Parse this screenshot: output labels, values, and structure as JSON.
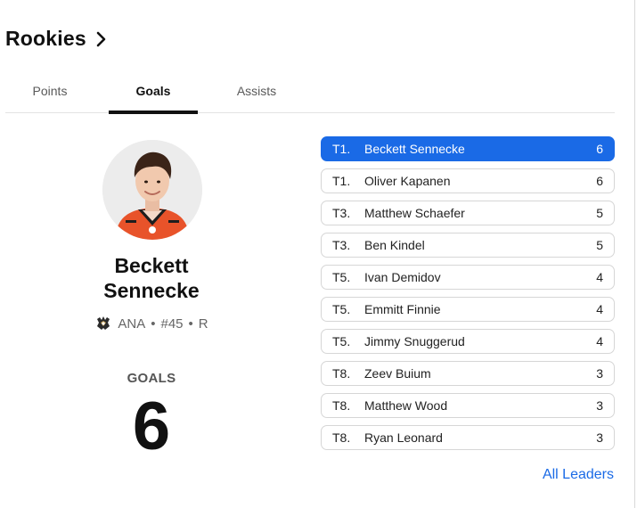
{
  "header": {
    "title": "Rookies"
  },
  "tabs": [
    {
      "label": "Points",
      "active": false
    },
    {
      "label": "Goals",
      "active": true
    },
    {
      "label": "Assists",
      "active": false
    }
  ],
  "featured": {
    "name_line1": "Beckett",
    "name_line2": "Sennecke",
    "team": "ANA",
    "number": "#45",
    "position": "R",
    "separator": "•",
    "team_logo_icon": "ducks-logo-icon",
    "stat_label": "GOALS",
    "stat_value": "6"
  },
  "leaders": [
    {
      "rank": "T1.",
      "name": "Beckett Sennecke",
      "value": "6"
    },
    {
      "rank": "T1.",
      "name": "Oliver Kapanen",
      "value": "6"
    },
    {
      "rank": "T3.",
      "name": "Matthew Schaefer",
      "value": "5"
    },
    {
      "rank": "T3.",
      "name": "Ben Kindel",
      "value": "5"
    },
    {
      "rank": "T5.",
      "name": "Ivan Demidov",
      "value": "4"
    },
    {
      "rank": "T5.",
      "name": "Emmitt Finnie",
      "value": "4"
    },
    {
      "rank": "T5.",
      "name": "Jimmy Snuggerud",
      "value": "4"
    },
    {
      "rank": "T8.",
      "name": "Zeev Buium",
      "value": "3"
    },
    {
      "rank": "T8.",
      "name": "Matthew Wood",
      "value": "3"
    },
    {
      "rank": "T8.",
      "name": "Ryan Leonard",
      "value": "3"
    }
  ],
  "all_leaders_link": "All Leaders",
  "colors": {
    "accent": "#1a6ae6",
    "jersey": "#e8532a",
    "text": "#111111"
  }
}
